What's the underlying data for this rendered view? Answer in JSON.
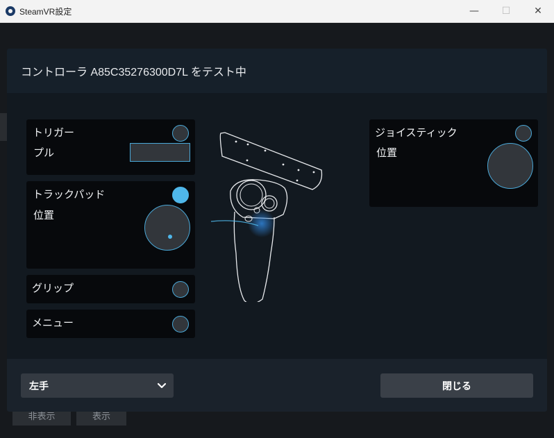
{
  "window": {
    "title": "SteamVR設定",
    "minimize": "—",
    "maximize": "☐",
    "close": "✕"
  },
  "background": {
    "hide_button": "非表示",
    "show_button": "表示"
  },
  "dialog": {
    "title": "コントローラ A85C35276300D7L をテスト中",
    "left_panels": {
      "trigger": {
        "label": "トリガー",
        "sub_label": "プル"
      },
      "trackpad": {
        "label": "トラックパッド",
        "sub_label": "位置"
      },
      "grip": {
        "label": "グリップ"
      },
      "menu": {
        "label": "メニュー"
      }
    },
    "right_panels": {
      "joystick": {
        "label": "ジョイスティック",
        "sub_label": "位置"
      }
    },
    "footer": {
      "hand_select": "左手",
      "close_button": "閉じる"
    }
  },
  "colors": {
    "accent": "#4fb7ea",
    "panel_bg": "#07090c",
    "dialog_bg": "#121920"
  },
  "icons": {
    "app": "steamvr-logo-icon",
    "dropdown": "chevron-down-icon"
  }
}
